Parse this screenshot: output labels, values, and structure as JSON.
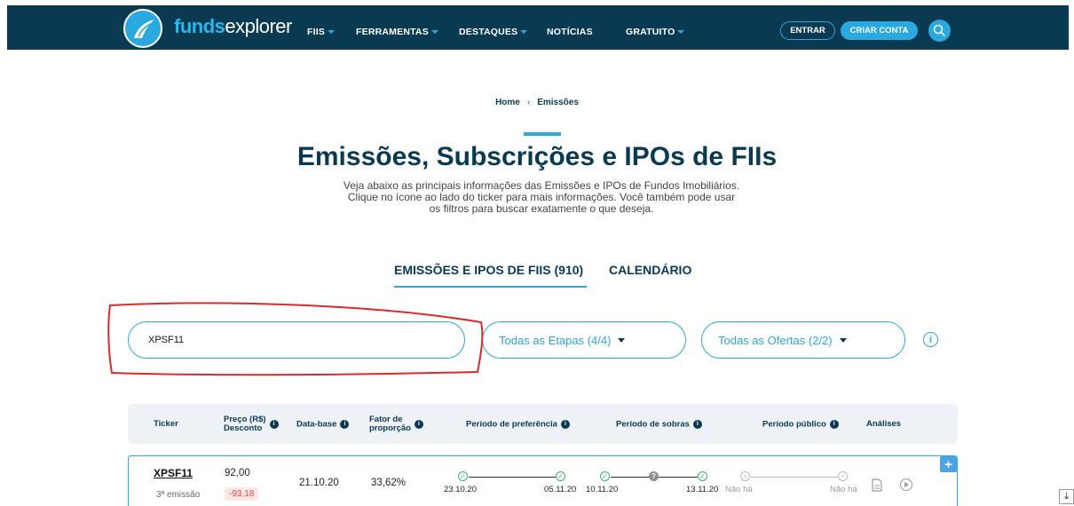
{
  "header": {
    "brand_bold": "funds",
    "brand_light": "explorer",
    "nav": [
      {
        "label": "FIIS",
        "has_caret": true
      },
      {
        "label": "FERRAMENTAS",
        "has_caret": true
      },
      {
        "label": "DESTAQUES",
        "has_caret": true
      },
      {
        "label": "NOTÍCIAS",
        "has_caret": false
      },
      {
        "label": "GRATUITO",
        "has_caret": true
      }
    ],
    "login_label": "ENTRAR",
    "signup_label": "CRIAR CONTA",
    "search_icon": "search-icon"
  },
  "breadcrumb": {
    "home": "Home",
    "separator": "›",
    "current": "Emissões"
  },
  "page": {
    "title": "Emissões, Subscrições e IPOs de FIIs",
    "subtitle_lines": [
      "Veja abaixo as principais informações das Emissões e IPOs de Fundos Imobiliários.",
      "Clique no ícone ao lado do ticker para mais informações. Você também pode usar",
      "os filtros para buscar exatamente o que deseja."
    ]
  },
  "tabs": [
    {
      "label": "EMISSÕES E IPOS DE FIIS (910)",
      "active": true
    },
    {
      "label": "CALENDÁRIO",
      "active": false
    }
  ],
  "filters": {
    "search_value": "XPSF11",
    "stages_label": "Todas as Etapas (4/4)",
    "offers_label": "Todas as Ofertas (2/2)",
    "info_icon": "info-icon"
  },
  "table": {
    "headers": {
      "ticker": "Ticker",
      "price_line1": "Preço (R$)",
      "price_line2": "Desconto",
      "base_date": "Data-base",
      "factor_line1": "Fator de",
      "factor_line2": "proporção",
      "preference": "Período de preferência",
      "leftovers": "Período de sobras",
      "public": "Período público",
      "analyses": "Análises"
    },
    "rows": [
      {
        "ticker": "XPSF11",
        "emission": "3ª emissão",
        "price": "92,00",
        "discount": "-93,18",
        "base_date": "21.10.20",
        "factor": "33,62%",
        "preference_start": "23.10.20",
        "preference_end": "05.11.20",
        "leftovers_start": "10.11.20",
        "leftovers_end": "13.11.20",
        "public_start": "Não há",
        "public_end": "Não há"
      }
    ]
  },
  "colors": {
    "navbar": "#0a3a52",
    "accent": "#2aa8e0",
    "annotation": "#d92b2b"
  }
}
